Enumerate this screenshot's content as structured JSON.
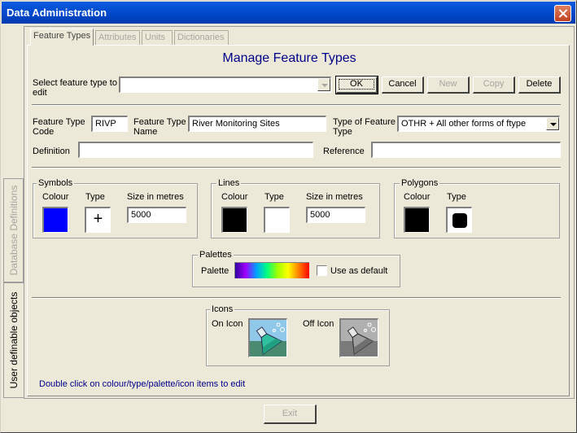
{
  "window": {
    "title": "Data Administration"
  },
  "left_tabs": [
    "Database Definitions",
    "User definable objects"
  ],
  "top_tabs": [
    "Feature Types",
    "Attributes",
    "Units",
    "Dictionaries"
  ],
  "heading": "Manage Feature Types",
  "select": {
    "label": "Select feature type to edit",
    "value": ""
  },
  "buttons": {
    "ok": "OK",
    "cancel": "Cancel",
    "new": "New",
    "copy": "Copy",
    "delete": "Delete",
    "exit": "Exit"
  },
  "fields": {
    "code_label": "Feature Type Code",
    "code_value": "RIVP",
    "name_label": "Feature Type Name",
    "name_value": "River Monitoring Sites",
    "type_label": "Type of Feature Type",
    "type_value": "OTHR + All other forms of ftype",
    "definition_label": "Definition",
    "definition_value": "",
    "reference_label": "Reference",
    "reference_value": ""
  },
  "symbols": {
    "title": "Symbols",
    "colour_label": "Colour",
    "type_label": "Type",
    "size_label": "Size in metres",
    "size_value": "5000",
    "colour": "#0000ff",
    "type_glyph": "+"
  },
  "lines": {
    "title": "Lines",
    "colour_label": "Colour",
    "type_label": "Type",
    "size_label": "Size in metres",
    "size_value": "5000",
    "colour": "#000000"
  },
  "polygons": {
    "title": "Polygons",
    "colour_label": "Colour",
    "type_label": "Type",
    "colour": "#000000"
  },
  "palettes": {
    "title": "Palettes",
    "palette_label": "Palette",
    "default_label": "Use as default",
    "default_checked": false
  },
  "icons": {
    "title": "Icons",
    "on_label": "On Icon",
    "off_label": "Off Icon",
    "on_icon": "flask-icon",
    "off_icon": "flask-icon"
  },
  "hint": "Double click on colour/type/palette/icon items to edit"
}
